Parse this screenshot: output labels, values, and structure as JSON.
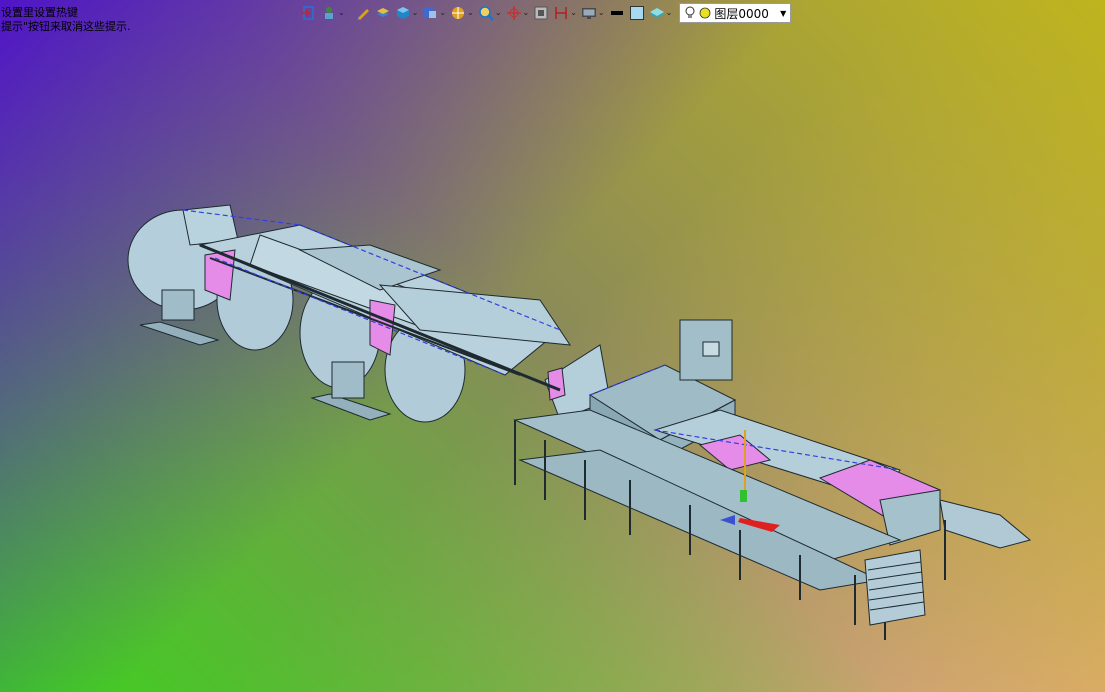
{
  "hint": {
    "line1": "设置里设置热键",
    "line2": "提示\"按钮来取消这些提示."
  },
  "toolbar": {
    "buttons": [
      {
        "name": "exit-icon",
        "color": "#2b6fd6"
      },
      {
        "name": "pointer-icon",
        "color": "#3a8a3a"
      },
      {
        "name": "pencil-icon",
        "color": "#d9a21e"
      },
      {
        "name": "layer-stack-icon",
        "color": "#3f7fd0"
      },
      {
        "name": "cube-icon",
        "color": "#1f86c9"
      },
      {
        "name": "view-cube-icon",
        "color": "#3b6bd1"
      },
      {
        "name": "render-sphere-icon",
        "color": "#e0a020"
      },
      {
        "name": "zoom-icon",
        "color": "#1a73c9"
      },
      {
        "name": "rotate-axis-icon",
        "color": "#c83030"
      },
      {
        "name": "section-icon",
        "color": "#555555"
      },
      {
        "name": "dimension-icon",
        "color": "#b02020"
      },
      {
        "name": "display-icon",
        "color": "#4a4a4a"
      },
      {
        "name": "line-weight-icon",
        "color": "#000000"
      },
      {
        "name": "color-swatch-icon",
        "color": "#a8d8f0"
      },
      {
        "name": "layer-manager-icon",
        "color": "#3aa3b0"
      }
    ],
    "layer_selector": {
      "value": "图层0000",
      "dropdown_glyph": "▼"
    }
  },
  "colors": {
    "machine_fill": "#a9c6d2",
    "machine_stroke": "#1e2a30",
    "material_pink": "#e58be8",
    "material_edge": "#3340e0"
  }
}
